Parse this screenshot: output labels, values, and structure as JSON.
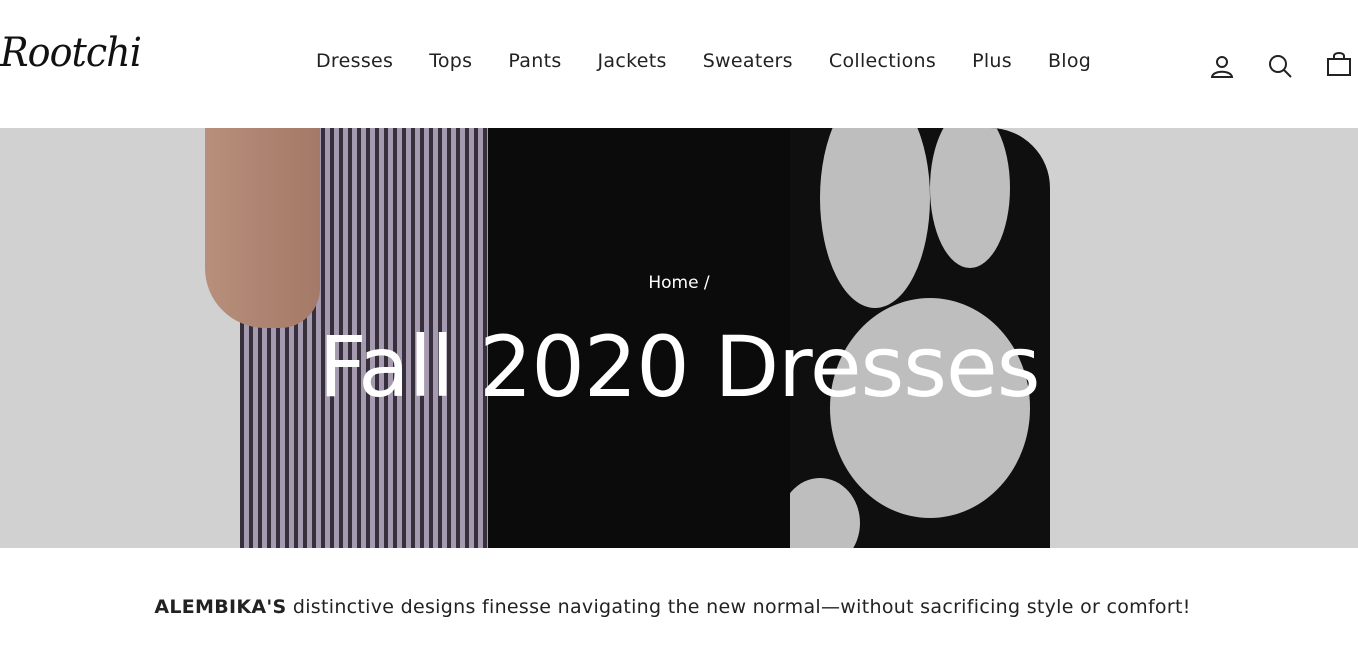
{
  "brand": {
    "logo_text": "Rootchi"
  },
  "nav": {
    "items": [
      {
        "label": "Dresses"
      },
      {
        "label": "Tops"
      },
      {
        "label": "Pants"
      },
      {
        "label": "Jackets"
      },
      {
        "label": "Sweaters"
      },
      {
        "label": "Collections"
      },
      {
        "label": "Plus"
      },
      {
        "label": "Blog"
      }
    ]
  },
  "header_icons": {
    "account": "user-icon",
    "search": "search-icon",
    "cart": "bag-icon"
  },
  "hero": {
    "breadcrumb": "Home /",
    "title": "Fall 2020 Dresses"
  },
  "description": {
    "brand": "ALEMBIKA'S",
    "text": " distinctive designs finesse navigating the new normal—without sacrificing style or comfort!"
  },
  "colors": {
    "text": "#222222",
    "hero_bg": "#e3e3e3",
    "white": "#ffffff"
  }
}
